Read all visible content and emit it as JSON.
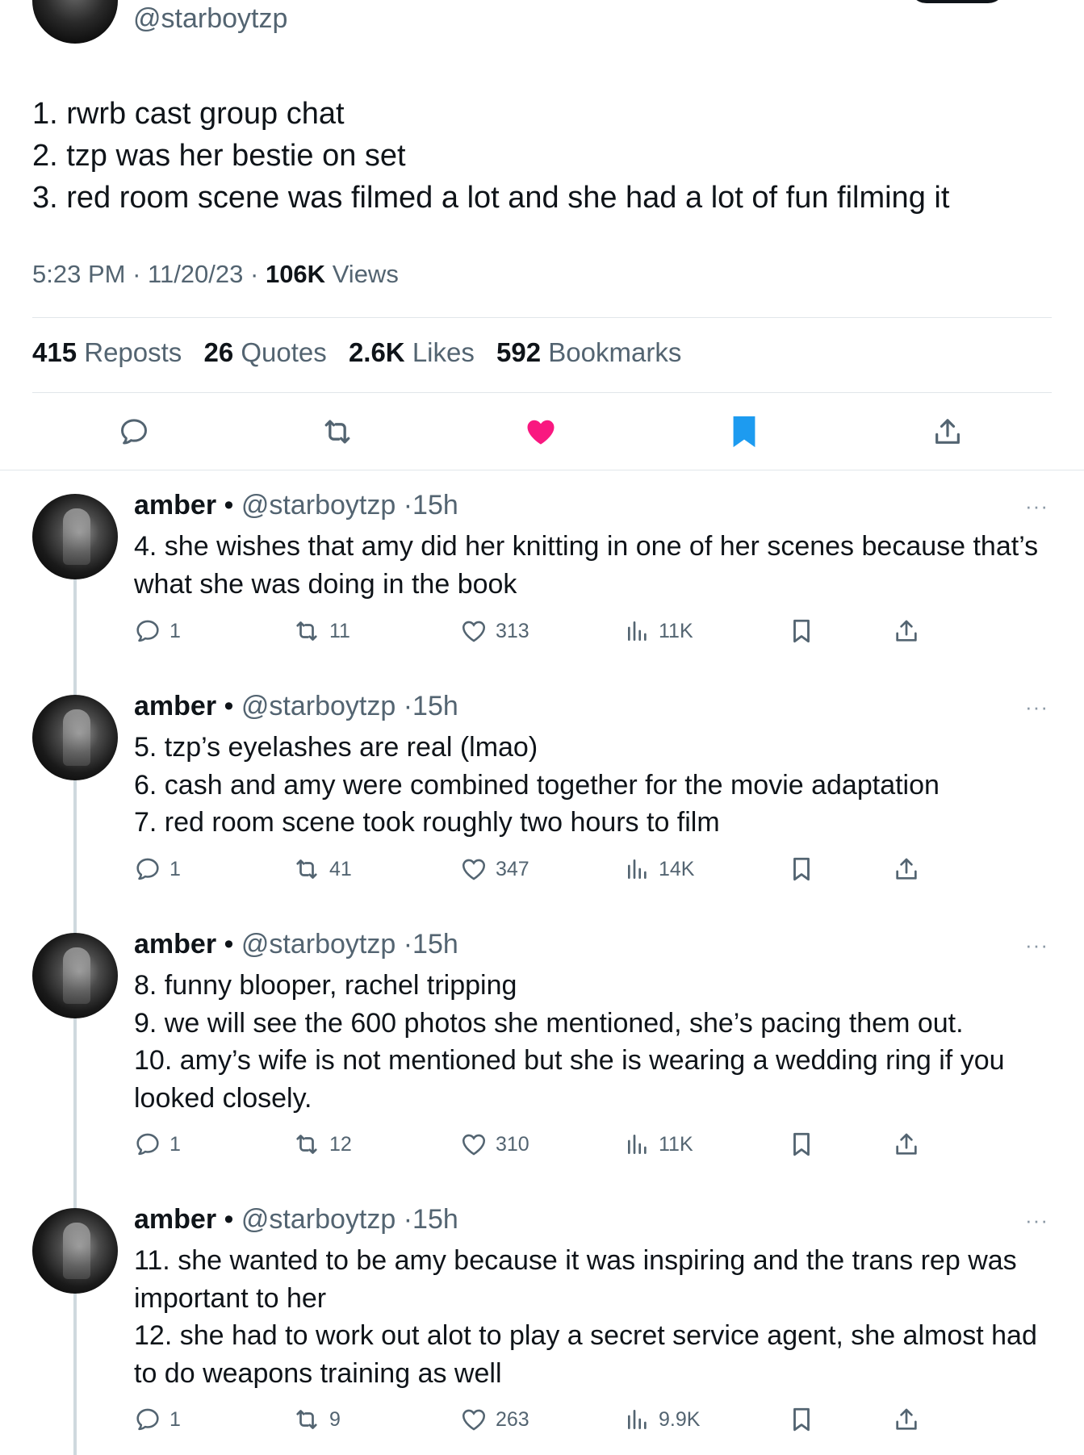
{
  "main_tweet": {
    "handle": "@starboytzp",
    "lines": [
      "1. rwrb cast group chat",
      "2. tzp was her bestie on set",
      "3. red room scene was filmed a lot and she had a lot of fun filming it"
    ],
    "time": "5:23 PM",
    "date": "11/20/23",
    "views_count": "106K",
    "views_label": "Views",
    "stats": {
      "reposts_count": "415",
      "reposts_label": "Reposts",
      "quotes_count": "26",
      "quotes_label": "Quotes",
      "likes_count": "2.6K",
      "likes_label": "Likes",
      "bookmarks_count": "592",
      "bookmarks_label": "Bookmarks"
    },
    "actions": [
      "reply-icon",
      "repost-icon",
      "like-icon-filled",
      "bookmark-icon-filled",
      "share-icon"
    ],
    "colors": {
      "like": "#f91880",
      "bookmark": "#1d9bf0",
      "icon": "#536471"
    }
  },
  "replies": [
    {
      "name": "amber",
      "separator": "•",
      "handle": "@starboytzp",
      "time": "15h",
      "more": "···",
      "lines": [
        "4. she wishes that amy did her knitting in one of her scenes because that’s what she was doing in the book"
      ],
      "replies": "1",
      "reposts": "11",
      "likes": "313",
      "views": "11K"
    },
    {
      "name": "amber",
      "separator": "•",
      "handle": "@starboytzp",
      "time": "15h",
      "more": "···",
      "lines": [
        "5. tzp’s eyelashes are real (lmao)",
        "6. cash and amy were combined together for the movie adaptation",
        "7. red room scene took roughly two hours to film"
      ],
      "replies": "1",
      "reposts": "41",
      "likes": "347",
      "views": "14K"
    },
    {
      "name": "amber",
      "separator": "•",
      "handle": "@starboytzp",
      "time": "15h",
      "more": "···",
      "lines": [
        "8. funny blooper, rachel tripping",
        "9. we will see the 600 photos she mentioned, she’s pacing them out.",
        "10. amy’s wife is not mentioned but she is wearing a wedding ring if you looked closely."
      ],
      "replies": "1",
      "reposts": "12",
      "likes": "310",
      "views": "11K"
    },
    {
      "name": "amber",
      "separator": "•",
      "handle": "@starboytzp",
      "time": "15h",
      "more": "···",
      "lines": [
        "11. she wanted to be amy because it was inspiring and the trans rep was important to her",
        "12. she had to work out alot to play a secret service agent, she almost had to do weapons training as well"
      ],
      "replies": "1",
      "reposts": "9",
      "likes": "263",
      "views": "9.9K"
    }
  ]
}
